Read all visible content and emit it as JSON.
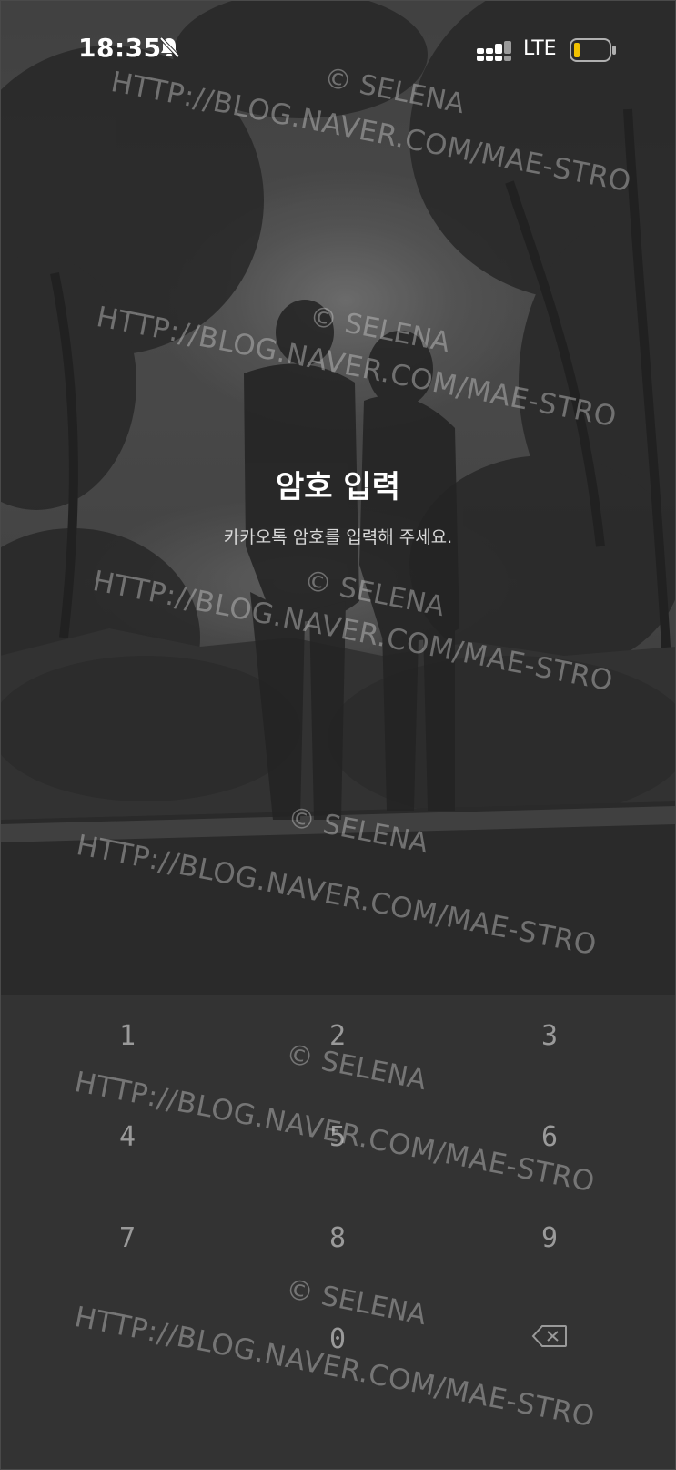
{
  "status_bar": {
    "time": "18:35",
    "network": "LTE",
    "battery_color": "#f2c200"
  },
  "lock": {
    "title": "암호 입력",
    "subtitle": "카카오톡 암호를 입력해 주세요."
  },
  "keypad": {
    "keys": [
      "1",
      "2",
      "3",
      "4",
      "5",
      "6",
      "7",
      "8",
      "9",
      "0"
    ],
    "delete_icon": "backspace-icon"
  },
  "watermark": {
    "copyright": "© SELENA",
    "url": "HTTP://BLOG.NAVER.COM/MAE-STRO"
  }
}
